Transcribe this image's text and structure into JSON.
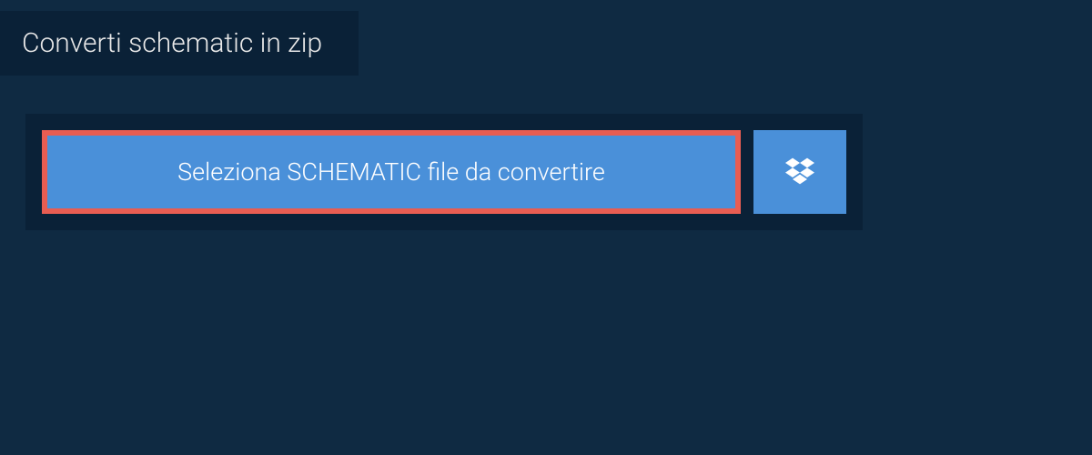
{
  "header": {
    "title": "Converti schematic in zip"
  },
  "actions": {
    "select_file_label": "Seleziona SCHEMATIC file da convertire"
  },
  "colors": {
    "background": "#0f2a42",
    "panel": "#0a2137",
    "button": "#4a90d9",
    "highlight_border": "#e85d52",
    "text_light": "#ffffff"
  }
}
